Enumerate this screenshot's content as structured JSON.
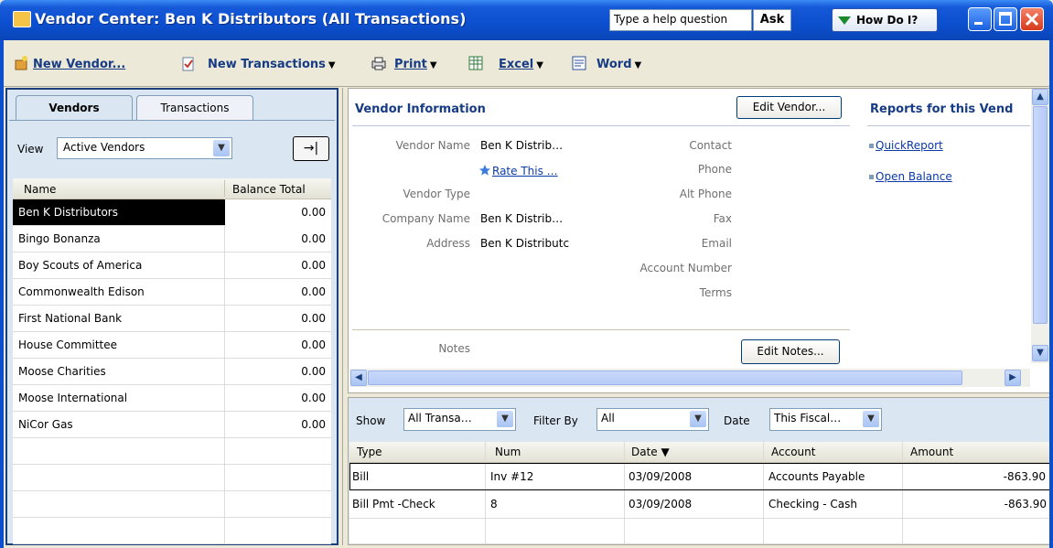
{
  "window": {
    "title": "Vendor Center: Ben K Distributors (All Transactions)",
    "help_placeholder": "Type a help question",
    "ask_label": "Ask",
    "howdoi_label": "How Do I?"
  },
  "toolbar": {
    "new_vendor": "New Vendor...",
    "new_transactions": "New Transactions",
    "print": "Print",
    "excel": "Excel",
    "word": "Word"
  },
  "left": {
    "tabs": [
      "Vendors",
      "Transactions"
    ],
    "view_label": "View",
    "view_value": "Active Vendors",
    "col_name": "Name",
    "col_balance": "Balance Total",
    "vendors": [
      {
        "name": "Ben K Distributors",
        "balance": "0.00"
      },
      {
        "name": "Bingo Bonanza",
        "balance": "0.00"
      },
      {
        "name": "Boy Scouts of America",
        "balance": "0.00"
      },
      {
        "name": "Commonwealth Edison",
        "balance": "0.00"
      },
      {
        "name": "First National Bank",
        "balance": "0.00"
      },
      {
        "name": "House Committee",
        "balance": "0.00"
      },
      {
        "name": "Moose Charities",
        "balance": "0.00"
      },
      {
        "name": "Moose International",
        "balance": "0.00"
      },
      {
        "name": "NiCor Gas",
        "balance": "0.00"
      }
    ]
  },
  "info": {
    "title": "Vendor Information",
    "edit_vendor": "Edit Vendor...",
    "vendor_name_label": "Vendor Name",
    "vendor_name": "Ben K Distrib…",
    "rate_link": "Rate This …",
    "vendor_type_label": "Vendor Type",
    "company_name_label": "Company Name",
    "company_name": "Ben K Distrib…",
    "address_label": "Address",
    "address": "Ben K Distributc",
    "contact_label": "Contact",
    "phone_label": "Phone",
    "alt_phone_label": "Alt Phone",
    "fax_label": "Fax",
    "email_label": "Email",
    "account_number_label": "Account Number",
    "terms_label": "Terms",
    "notes_label": "Notes",
    "edit_notes": "Edit Notes..."
  },
  "reports": {
    "title": "Reports for this Vend",
    "links": [
      "QuickReport",
      "Open Balance"
    ]
  },
  "transactions": {
    "show_label": "Show",
    "show_value": "All Transa…",
    "filter_label": "Filter By",
    "filter_value": "All",
    "date_label": "Date",
    "date_value": "This Fiscal…",
    "columns": [
      "Type",
      "Num",
      "Date ▼",
      "Account",
      "Amount"
    ],
    "rows": [
      {
        "type": "Bill",
        "num": "Inv #12",
        "date": "03/09/2008",
        "account": "Accounts Payable",
        "amount": "-863.90"
      },
      {
        "type": "Bill Pmt -Check",
        "num": "8",
        "date": "03/09/2008",
        "account": "Checking - Cash",
        "amount": "-863.90"
      }
    ]
  }
}
